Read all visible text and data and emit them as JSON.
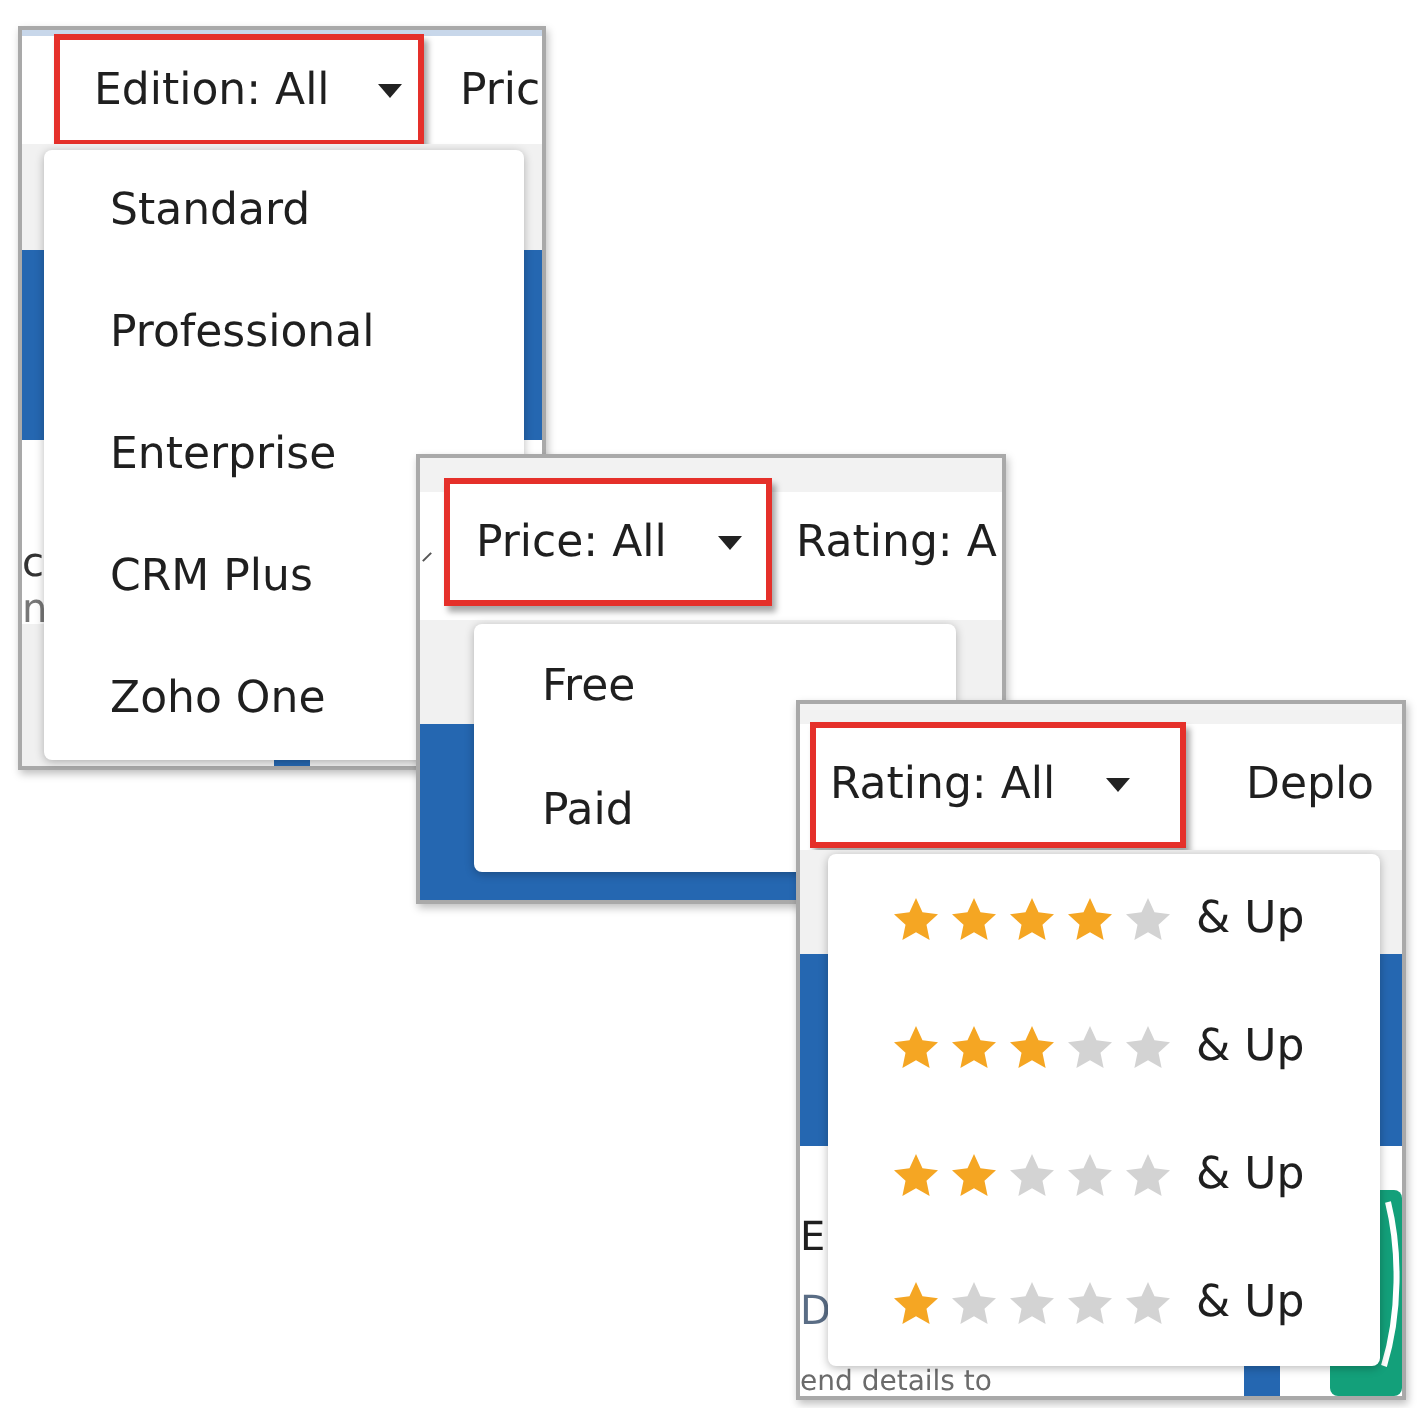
{
  "panels": [
    {
      "filters": [
        {
          "label": "Edition: All",
          "open": true
        },
        {
          "label": "Pric",
          "open": false
        }
      ],
      "menu": {
        "items": [
          {
            "kind": "option",
            "label": "Standard"
          },
          {
            "kind": "option",
            "label": "Professional"
          },
          {
            "kind": "option",
            "label": "Enterprise"
          },
          {
            "kind": "option",
            "label": "CRM Plus"
          },
          {
            "kind": "option",
            "label": "Zoho One"
          }
        ]
      },
      "page_texts": [
        "c",
        "n"
      ]
    },
    {
      "filters": [
        {
          "label": "Price: All",
          "open": true
        },
        {
          "label": "Rating: A",
          "open": false
        }
      ],
      "menu": {
        "items": [
          {
            "kind": "option",
            "label": "Free"
          },
          {
            "kind": "option",
            "label": "Paid"
          }
        ]
      }
    },
    {
      "filters": [
        {
          "label": "Rating: All",
          "open": true
        },
        {
          "label": "Deplo",
          "open": false
        }
      ],
      "menu": {
        "items": [
          {
            "kind": "rating",
            "stars": 4,
            "label": "& Up"
          },
          {
            "kind": "rating",
            "stars": 3,
            "label": "& Up"
          },
          {
            "kind": "rating",
            "stars": 2,
            "label": "& Up"
          },
          {
            "kind": "rating",
            "stars": 1,
            "label": "& Up"
          }
        ]
      },
      "page_texts": [
        "E",
        "D",
        "end details to"
      ]
    }
  ]
}
